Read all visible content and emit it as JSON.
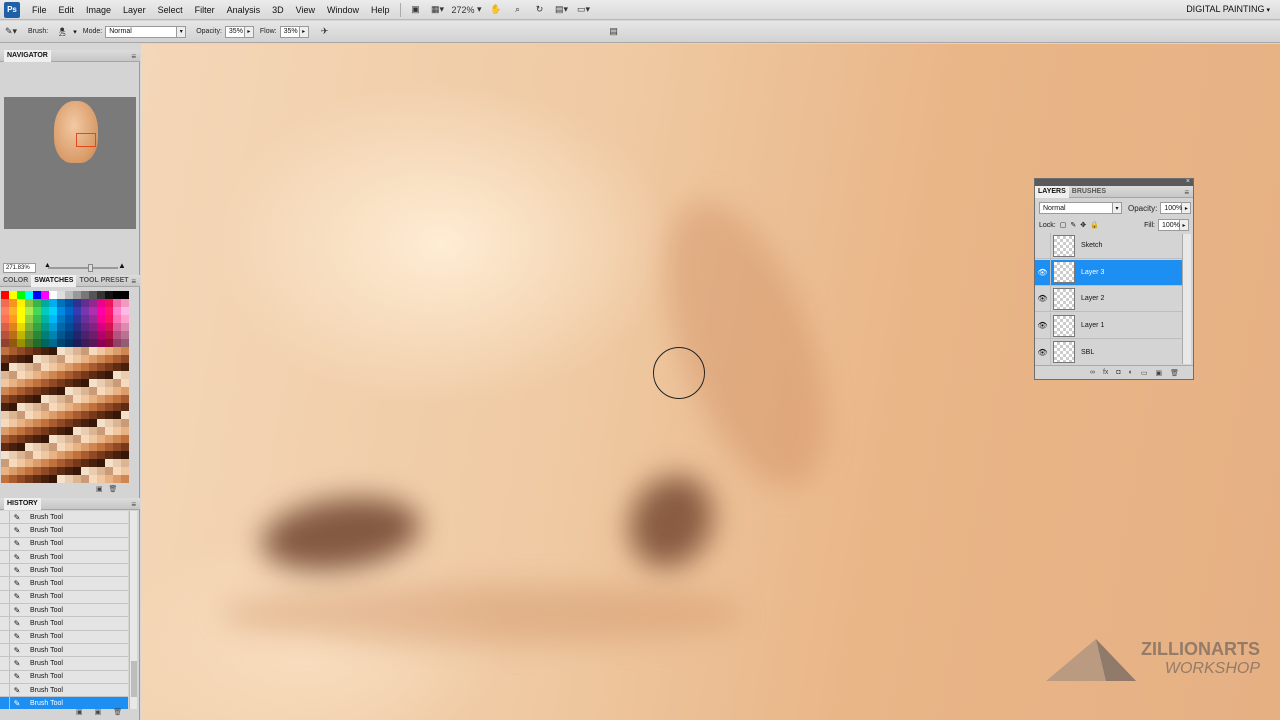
{
  "app": {
    "logo": "Ps",
    "workspace": "DIGITAL PAINTING",
    "zoom": "272%"
  },
  "menu": [
    "File",
    "Edit",
    "Image",
    "Layer",
    "Select",
    "Filter",
    "Analysis",
    "3D",
    "View",
    "Window",
    "Help"
  ],
  "options": {
    "brush_label": "Brush:",
    "brush_size": "25",
    "mode_label": "Mode:",
    "mode_value": "Normal",
    "opacity_label": "Opacity:",
    "opacity_value": "35%",
    "flow_label": "Flow:",
    "flow_value": "35%"
  },
  "navigator": {
    "title": "NAVIGATOR",
    "zoom_value": "271.83%"
  },
  "swatches": {
    "tabs": [
      "COLOR",
      "SWATCHES",
      "TOOL PRESET"
    ]
  },
  "history": {
    "title": "HISTORY",
    "items": [
      "Brush Tool",
      "Brush Tool",
      "Brush Tool",
      "Brush Tool",
      "Brush Tool",
      "Brush Tool",
      "Brush Tool",
      "Brush Tool",
      "Brush Tool",
      "Brush Tool",
      "Brush Tool",
      "Brush Tool",
      "Brush Tool",
      "Brush Tool",
      "Brush Tool"
    ]
  },
  "layers": {
    "tabs": [
      "LAYERS",
      "BRUSHES"
    ],
    "blend_mode": "Normal",
    "opacity_label": "Opacity:",
    "opacity_value": "100%",
    "lock_label": "Lock:",
    "fill_label": "Fill:",
    "fill_value": "100%",
    "items": [
      {
        "name": "Sketch",
        "visible": false,
        "selected": false
      },
      {
        "name": "Layer 3",
        "visible": true,
        "selected": true
      },
      {
        "name": "Layer 2",
        "visible": true,
        "selected": false
      },
      {
        "name": "Layer 1",
        "visible": true,
        "selected": false
      },
      {
        "name": "SBL",
        "visible": true,
        "selected": false
      }
    ]
  },
  "watermark": {
    "line1": "ZILLIONARTS",
    "line2": "WORKSHOP"
  },
  "colors": {
    "foreground": "#c6926e",
    "background": "#ffffff",
    "selection": "#1d8ef2"
  }
}
